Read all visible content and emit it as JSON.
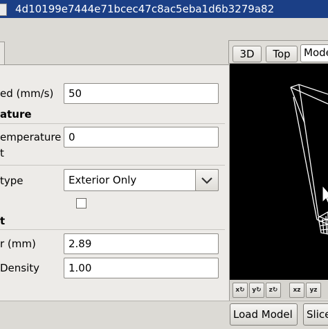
{
  "window": {
    "title": "4d10199e7444e71bcec47c8ac5eba1d6b3279a82"
  },
  "settings": {
    "speed_label": "ed (mm/s)",
    "speed_value": "50",
    "temperature_header": "ature",
    "temperature_label": "emperature",
    "temperature_sub": "t",
    "temperature_value": "0",
    "type_label": "type",
    "type_selected": "Exterior Only",
    "filament_header": "t",
    "diameter_label": "r (mm)",
    "diameter_value": "2.89",
    "density_label": "Density",
    "density_value": "1.00"
  },
  "view": {
    "buttons": [
      "3D",
      "Top",
      "Mode"
    ]
  },
  "bottom": {
    "load_model": "Load Model",
    "slice": "Slice"
  },
  "axis_buttons": [
    "x",
    "y",
    "z",
    "xz",
    "yz"
  ]
}
